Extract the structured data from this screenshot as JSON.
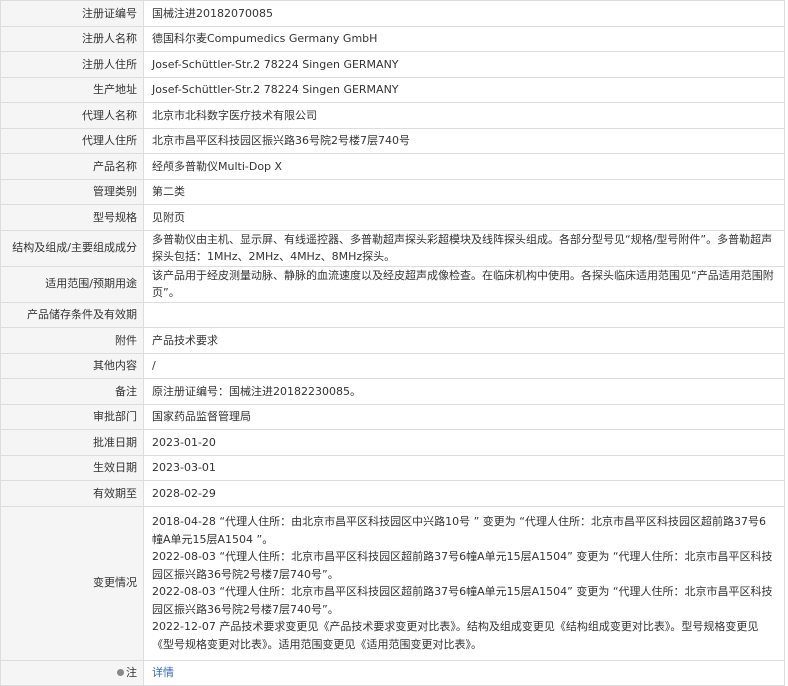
{
  "rows": [
    {
      "label": "注册证编号",
      "value": "国械注进20182070085"
    },
    {
      "label": "注册人名称",
      "value": "德国科尔麦Compumedics Germany GmbH"
    },
    {
      "label": "注册人住所",
      "value": "Josef-Schüttler-Str.2 78224 Singen GERMANY"
    },
    {
      "label": "生产地址",
      "value": "Josef-Schüttler-Str.2 78224 Singen GERMANY"
    },
    {
      "label": "代理人名称",
      "value": "北京市北科数字医疗技术有限公司"
    },
    {
      "label": "代理人住所",
      "value": "北京市昌平区科技园区振兴路36号院2号楼7层740号"
    },
    {
      "label": "产品名称",
      "value": "经颅多普勒仪Multi-Dop X"
    },
    {
      "label": "管理类别",
      "value": "第二类"
    },
    {
      "label": "型号规格",
      "value": "见附页"
    },
    {
      "label": "结构及组成/主要组成成分",
      "value": "多普勒仪由主机、显示屏、有线遥控器、多普勒超声探头彩超模块及线阵探头组成。各部分型号见“规格/型号附件”。多普勒超声探头包括：1MHz、2MHz、4MHz、8MHz探头。"
    },
    {
      "label": "适用范围/预期用途",
      "value": "该产品用于经皮测量动脉、静脉的血流速度以及经皮超声成像检查。在临床机构中使用。各探头临床适用范围见“产品适用范围附页”。"
    },
    {
      "label": "产品储存条件及有效期",
      "value": ""
    },
    {
      "label": "附件",
      "value": "产品技术要求"
    },
    {
      "label": "其他内容",
      "value": "/"
    },
    {
      "label": "备注",
      "value": "原注册证编号：国械注进20182230085。"
    },
    {
      "label": "审批部门",
      "value": "国家药品监督管理局"
    },
    {
      "label": "批准日期",
      "value": "2023-01-20"
    },
    {
      "label": "生效日期",
      "value": "2023-03-01"
    },
    {
      "label": "有效期至",
      "value": "2028-02-29"
    }
  ],
  "changes": {
    "label": "变更情况",
    "lines": [
      "2018-04-28 “代理人住所：由北京市昌平区科技园区中兴路10号 ” 变更为 “代理人住所：北京市昌平区科技园区超前路37号6幢A单元15层A1504 ”。",
      "2022-08-03 “代理人住所：北京市昌平区科技园区超前路37号6幢A单元15层A1504” 变更为 “代理人住所：北京市昌平区科技园区振兴路36号院2号楼7层740号”。",
      "2022-08-03 “代理人住所：北京市昌平区科技园区超前路37号6幢A单元15层A1504” 变更为 “代理人住所：北京市昌平区科技园区振兴路36号院2号楼7层740号”。",
      "2022-12-07 产品技术要求变更见《产品技术要求变更对比表》。结构及组成变更见《结构组成变更对比表》。型号规格变更见《型号规格变更对比表》。适用范围变更见《适用范围变更对比表》。"
    ]
  },
  "note": {
    "label": "注",
    "link_text": "详情",
    "icon": "pin-icon"
  }
}
